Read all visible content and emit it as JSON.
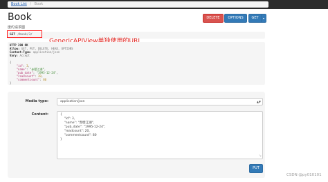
{
  "breadcrumb": {
    "items": [
      "Book List",
      "Book"
    ],
    "separator": "/"
  },
  "page": {
    "title": "Book",
    "description": "度约请求图"
  },
  "toolbar": {
    "delete_label": "DELETE",
    "options_label": "OPTIONS",
    "get_label": "GET",
    "get_toggle_icon": "▾"
  },
  "request": {
    "method": "GET",
    "url": "/book/3/"
  },
  "annotation": {
    "text": "GenericAPIView单独使用的URL"
  },
  "response": {
    "status": "HTTP 200 OK",
    "headers": [
      {
        "name": "Allow:",
        "value": "GET, PUT, DELETE, HEAD, OPTIONS"
      },
      {
        "name": "Content-Type:",
        "value": "application/json"
      },
      {
        "name": "Vary:",
        "value": "Accept"
      }
    ],
    "body": {
      "open": "{",
      "close": "}",
      "fields": [
        {
          "key": "\"id\"",
          "value": "3",
          "type": "num",
          "comma": ","
        },
        {
          "key": "\"name\"",
          "value": "\"赤壁江湖\"",
          "type": "str",
          "comma": ","
        },
        {
          "key": "\"pub_date\"",
          "value": "\"1995-12-24\"",
          "type": "str",
          "comma": ","
        },
        {
          "key": "\"readcount\"",
          "value": "20",
          "type": "num",
          "comma": ","
        },
        {
          "key": "\"commentcount\"",
          "value": "80",
          "type": "num",
          "comma": ""
        }
      ]
    }
  },
  "form": {
    "media_type_label": "Media type:",
    "media_type_value": "application/json",
    "content_label": "Content:",
    "content_lines": [
      "{",
      "    \"id\": 3,",
      "    \"name\": \"赤壁江湖\",",
      "    \"pub_date\": \"1995-12-24\",",
      "    \"readcount\": 20,",
      "    \"commentcount\": 80",
      "}"
    ],
    "put_label": "PUT"
  },
  "watermark": "CSDN @py010101",
  "colors": {
    "danger": "#d9534f",
    "primary": "#337ab7",
    "annotation": "#e0201b",
    "navbar": "#2c2c2c"
  }
}
